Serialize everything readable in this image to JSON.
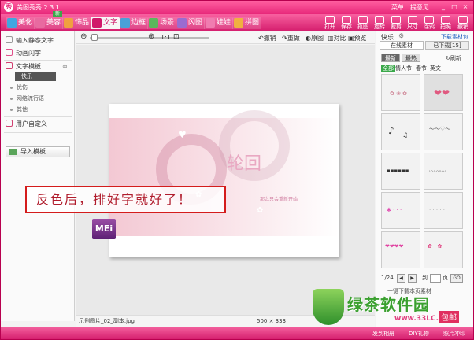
{
  "title_bar": {
    "app_title": "美图秀秀 2.3.1",
    "menu": "菜单",
    "user": "提意见"
  },
  "main_tabs": [
    {
      "label": "美化",
      "color": "#3fa7e0"
    },
    {
      "label": "美容",
      "color": "#e86aa0",
      "badge": "新"
    },
    {
      "label": "饰品",
      "color": "#f0a040"
    },
    {
      "label": "文字",
      "color": "#d01a6a"
    },
    {
      "label": "边框",
      "color": "#4aa0d8"
    },
    {
      "label": "场景",
      "color": "#5cb85c"
    },
    {
      "label": "闪图",
      "color": "#9a6cd0"
    },
    {
      "label": "娃娃",
      "color": "#f07cb0"
    },
    {
      "label": "拼图",
      "color": "#f0b040"
    }
  ],
  "toolbar": [
    "打开",
    "保存",
    "抠图",
    "旋转",
    "裁剪",
    "尺寸",
    "涂鸦",
    "拍照",
    "撤销"
  ],
  "left_panel": {
    "input_static": "输入静态文字",
    "animated": "动画闪字",
    "template": "文字模板",
    "template_items": [
      "快乐",
      "忧伤",
      "网络流行语",
      "其他"
    ],
    "user_defined": "用户自定义",
    "import": "导入模板"
  },
  "zoom_bar": {
    "ratio": "1:1",
    "undo": "撤销",
    "redo": "重做",
    "original": "原图",
    "compare": "对比",
    "preview": "预览"
  },
  "canvas": {
    "photo_text_main": "轮回",
    "photo_text_small": "那么只会重新开始",
    "callout": "反色后，排好字就好了！",
    "logo": "MEi"
  },
  "status_bar": {
    "filename": "示例图片_02_副本.jpg",
    "size": "500 × 333"
  },
  "right_panel": {
    "category": "快乐",
    "download_more": "下载素材包",
    "tab_online": "在线素材",
    "tab_downloaded": "已下载[15]",
    "filter_new": "最新",
    "filter_hot": "最热",
    "refresh": "刷新",
    "categories": [
      "全部",
      "情人节",
      "春节",
      "英文"
    ],
    "page_info": "1/24",
    "goto_label": "到",
    "page_unit": "页",
    "go": "GO",
    "download_page": "一键下载本页素材",
    "thumbs": [
      "",
      "",
      "",
      "",
      "",
      "",
      "",
      "",
      "",
      "",
      "",
      ""
    ]
  },
  "bottom_bar": {
    "items": [
      "发到相册",
      "DIY礼物",
      "照片冲印"
    ]
  },
  "watermark": {
    "text": "绿茶软件园",
    "url": "www.33LC.com",
    "label": "包邮"
  }
}
